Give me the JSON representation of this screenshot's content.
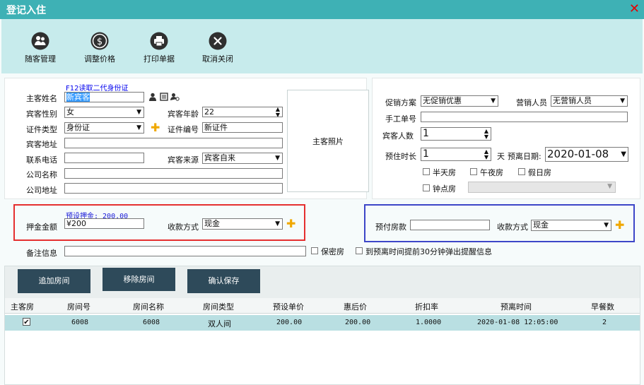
{
  "window": {
    "title": "登记入住",
    "close_icon": "✕"
  },
  "toolbar": [
    {
      "label": "随客管理",
      "icon": "people-icon"
    },
    {
      "label": "调整价格",
      "icon": "dollar-icon"
    },
    {
      "label": "打印单据",
      "icon": "printer-icon"
    },
    {
      "label": "取消关闭",
      "icon": "close-circle-icon"
    }
  ],
  "guest": {
    "id_reader_link": "F12读取二代身份证",
    "name_label": "主客姓名",
    "name_value": "新宾客",
    "gender_label": "宾客性别",
    "gender_value": "女",
    "age_label": "宾客年龄",
    "age_value": "22",
    "id_type_label": "证件类型",
    "id_type_value": "身份证",
    "id_no_label": "证件编号",
    "id_no_value": "新证件",
    "address_label": "宾客地址",
    "address_value": "",
    "phone_label": "联系电话",
    "phone_value": "",
    "source_label": "宾客来源",
    "source_value": "宾客自来",
    "company_label": "公司名称",
    "company_value": "",
    "company_addr_label": "公司地址",
    "company_addr_value": "",
    "photo_label": "主客照片"
  },
  "booking": {
    "promo_label": "促销方案",
    "promo_value": "无促销优惠",
    "sales_label": "营销人员",
    "sales_value": "无营销人员",
    "manual_no_label": "手工单号",
    "manual_no_value": "",
    "guests_label": "宾客人数",
    "guests_value": "1",
    "stay_label": "预住时长",
    "stay_value": "1",
    "stay_unit": "天",
    "depart_label": "预离日期:",
    "depart_value": "2020-01-08",
    "half_day": "半天房",
    "midnight": "午夜房",
    "holiday": "假日房",
    "hourly": "钟点房",
    "hourly_value": ""
  },
  "deposit": {
    "preset": "预设押金: 200.00",
    "amount_label": "押金金额",
    "amount_value": "¥200",
    "method_label": "收款方式",
    "method_value": "现金"
  },
  "prepay": {
    "label": "预付房款",
    "value": "",
    "method_label": "收款方式",
    "method_value": "现金"
  },
  "remark": {
    "label": "备注信息",
    "value": "",
    "secret": "保密房",
    "remind": "到预离时间提前30分钟弹出提醒信息"
  },
  "actions": {
    "add_room": "追加房间",
    "remove_room": "移除房间",
    "confirm_save": "确认保存"
  },
  "table": {
    "headers": [
      "主客房",
      "房间号",
      "房间名称",
      "房间类型",
      "预设单价",
      "惠后价",
      "折扣率",
      "预离时间",
      "早餐数"
    ],
    "rows": [
      {
        "main": "✔",
        "room_no": "6008",
        "room_name": "6008",
        "room_type": "双人间",
        "preset_price": "200.00",
        "disc_price": "200.00",
        "rate": "1.0000",
        "depart_time": "2020-01-08 12:05:00",
        "breakfast": "2"
      }
    ]
  }
}
